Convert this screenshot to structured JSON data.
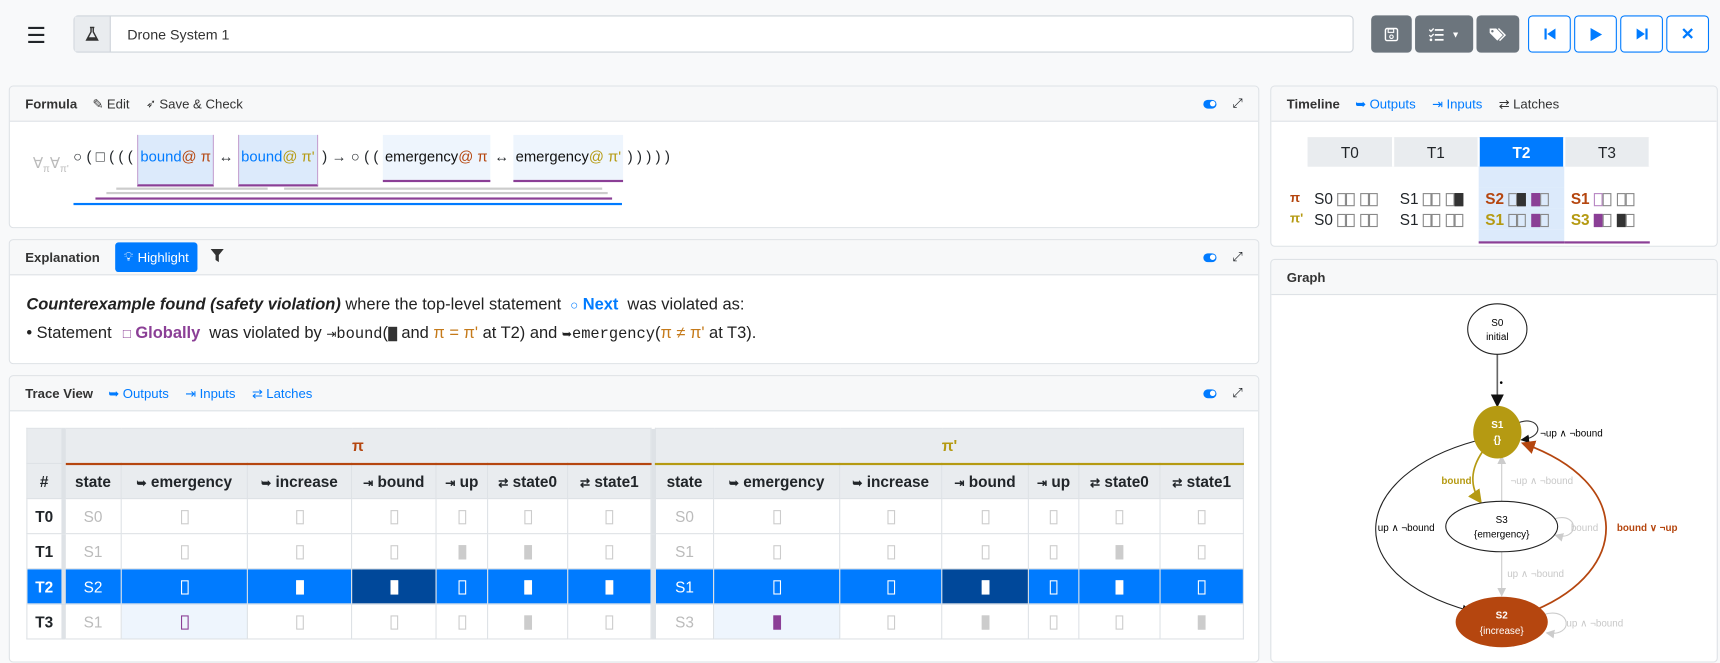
{
  "app": {
    "title": "Drone System 1",
    "menu_icon": "hamburger-icon",
    "project_icon": "flask-icon"
  },
  "toolbar": {
    "buttons": [
      {
        "name": "save-button",
        "icon": "floppy-disk-icon"
      },
      {
        "name": "checklist-dropdown-button",
        "icon": "task-list-icon"
      },
      {
        "name": "tags-button",
        "icon": "tags-icon"
      },
      {
        "name": "first-step-button",
        "icon": "step-backward-icon"
      },
      {
        "name": "play-button",
        "icon": "play-icon"
      },
      {
        "name": "step-forward-button",
        "icon": "step-forward-icon"
      },
      {
        "name": "close-button",
        "icon": "close-icon"
      }
    ]
  },
  "colors": {
    "accent": "#007bff",
    "pi": "#b5460f",
    "pi_prime": "#b59a12",
    "highlight": "#8b3f96",
    "violation_cell": "#00489a",
    "button_gray": "#6c757d"
  },
  "formula": {
    "title": "Formula",
    "edit": "Edit",
    "save_check": "Save & Check",
    "quantifier": "∀",
    "q_sub1": "π",
    "q_sub2": "π'",
    "tokens": [
      {
        "t": "○"
      },
      {
        "t": "("
      },
      {
        "t": "□"
      },
      {
        "t": "("
      },
      {
        "t": "("
      },
      {
        "t": "("
      },
      {
        "box": "b",
        "name": "bound",
        "at": "@",
        "trace": "π",
        "tc": "pi"
      },
      {
        "t": "↔"
      },
      {
        "box": "b",
        "name": "bound",
        "at": "@",
        "trace": "π'",
        "tc": "pi_prime"
      },
      {
        "t": ")"
      },
      {
        "t": "→"
      },
      {
        "t": "○"
      },
      {
        "t": "("
      },
      {
        "t": "("
      },
      {
        "box": "e",
        "name": "emergency",
        "at": "@",
        "trace": "π",
        "tc": "pi"
      },
      {
        "t": "↔"
      },
      {
        "box": "e",
        "name": "emergency",
        "at": "@",
        "trace": "π'",
        "tc": "pi_prime"
      },
      {
        "t": ")"
      },
      {
        "t": ")"
      },
      {
        "t": ")"
      },
      {
        "t": ")"
      },
      {
        "t": ")"
      }
    ]
  },
  "explanation": {
    "title": "Explanation",
    "highlight": "Highlight",
    "line1": {
      "bold": "Counterexample found (safety violation)",
      "mid": "where the top-level statement",
      "op_symbol": "○",
      "op": "Next",
      "end": "was violated as:"
    },
    "line2": {
      "bullet": "• Statement",
      "op_symbol": "□",
      "op": "Globally",
      "mid": "was violated by",
      "sig1": "bound",
      "and1": "and",
      "eq": "π = π'",
      "at1": "at T2",
      "and2": "and",
      "sig2": "emergency",
      "neq": "π ≠ π'",
      "at2": "at T3)."
    }
  },
  "trace": {
    "title": "Trace View",
    "tabs": [
      "Outputs",
      "Inputs",
      "Latches"
    ],
    "hash": "#",
    "traces": [
      {
        "label": "π",
        "key": "pi"
      },
      {
        "label": "π'",
        "key": "pi_prime"
      }
    ],
    "columns": [
      {
        "name": "state",
        "kind": "state"
      },
      {
        "name": "emergency",
        "kind": "output"
      },
      {
        "name": "increase",
        "kind": "output"
      },
      {
        "name": "bound",
        "kind": "input"
      },
      {
        "name": "up",
        "kind": "input"
      },
      {
        "name": "state0",
        "kind": "latch"
      },
      {
        "name": "state1",
        "kind": "latch"
      }
    ],
    "selected_step": "T2",
    "rows": [
      {
        "step": "T0",
        "pi": {
          "state": "S0",
          "values": [
            false,
            false,
            false,
            false,
            false,
            false
          ]
        },
        "pi_prime": {
          "state": "S0",
          "values": [
            false,
            false,
            false,
            false,
            false,
            false
          ]
        }
      },
      {
        "step": "T1",
        "pi": {
          "state": "S1",
          "values": [
            false,
            false,
            false,
            true,
            true,
            false
          ]
        },
        "pi_prime": {
          "state": "S1",
          "values": [
            false,
            false,
            false,
            false,
            true,
            false
          ]
        }
      },
      {
        "step": "T2",
        "pi": {
          "state": "S2",
          "values": [
            false,
            true,
            true,
            false,
            true,
            true
          ]
        },
        "pi_prime": {
          "state": "S1",
          "values": [
            false,
            false,
            true,
            false,
            true,
            false
          ]
        }
      },
      {
        "step": "T3",
        "pi": {
          "state": "S1",
          "values": [
            false,
            false,
            false,
            false,
            true,
            false
          ]
        },
        "pi_prime": {
          "state": "S3",
          "values": [
            true,
            false,
            true,
            false,
            false,
            true
          ]
        }
      }
    ],
    "highlighted_cells": [
      {
        "trace": "pi",
        "step": "T2",
        "signal": "bound"
      },
      {
        "trace": "pi_prime",
        "step": "T2",
        "signal": "bound"
      },
      {
        "trace": "pi",
        "step": "T3",
        "signal": "emergency"
      },
      {
        "trace": "pi_prime",
        "step": "T3",
        "signal": "emergency"
      }
    ]
  },
  "timeline": {
    "title": "Timeline",
    "tabs": [
      "Outputs",
      "Inputs",
      "Latches"
    ],
    "steps": [
      "T0",
      "T1",
      "T2",
      "T3"
    ],
    "highlighted_steps": [
      "T2",
      "T3"
    ]
  },
  "graph": {
    "title": "Graph",
    "nodes": [
      {
        "id": "S0",
        "label": "initial"
      },
      {
        "id": "S1",
        "label": "{}"
      },
      {
        "id": "S3",
        "label": "{emergency}"
      },
      {
        "id": "S2",
        "label": "{increase}"
      }
    ],
    "edges": [
      {
        "from": "S0",
        "to": "S1",
        "label": "•"
      },
      {
        "from": "S1",
        "to": "S1",
        "label": "¬up ∧ ¬bound"
      },
      {
        "from": "S1",
        "to": "S3",
        "label": "bound"
      },
      {
        "from": "S3",
        "to": "S1",
        "label": "¬up ∧ ¬bound"
      },
      {
        "from": "S3",
        "to": "S3",
        "label": "bound"
      },
      {
        "from": "S3",
        "to": "S2",
        "label": "up ∧ ¬bound"
      },
      {
        "from": "S1",
        "to": "S2",
        "label": "up ∧ ¬bound"
      },
      {
        "from": "S2",
        "to": "S1",
        "label": "bound ∨ ¬up"
      },
      {
        "from": "S2",
        "to": "S2",
        "label": "up ∧ ¬bound"
      }
    ]
  }
}
